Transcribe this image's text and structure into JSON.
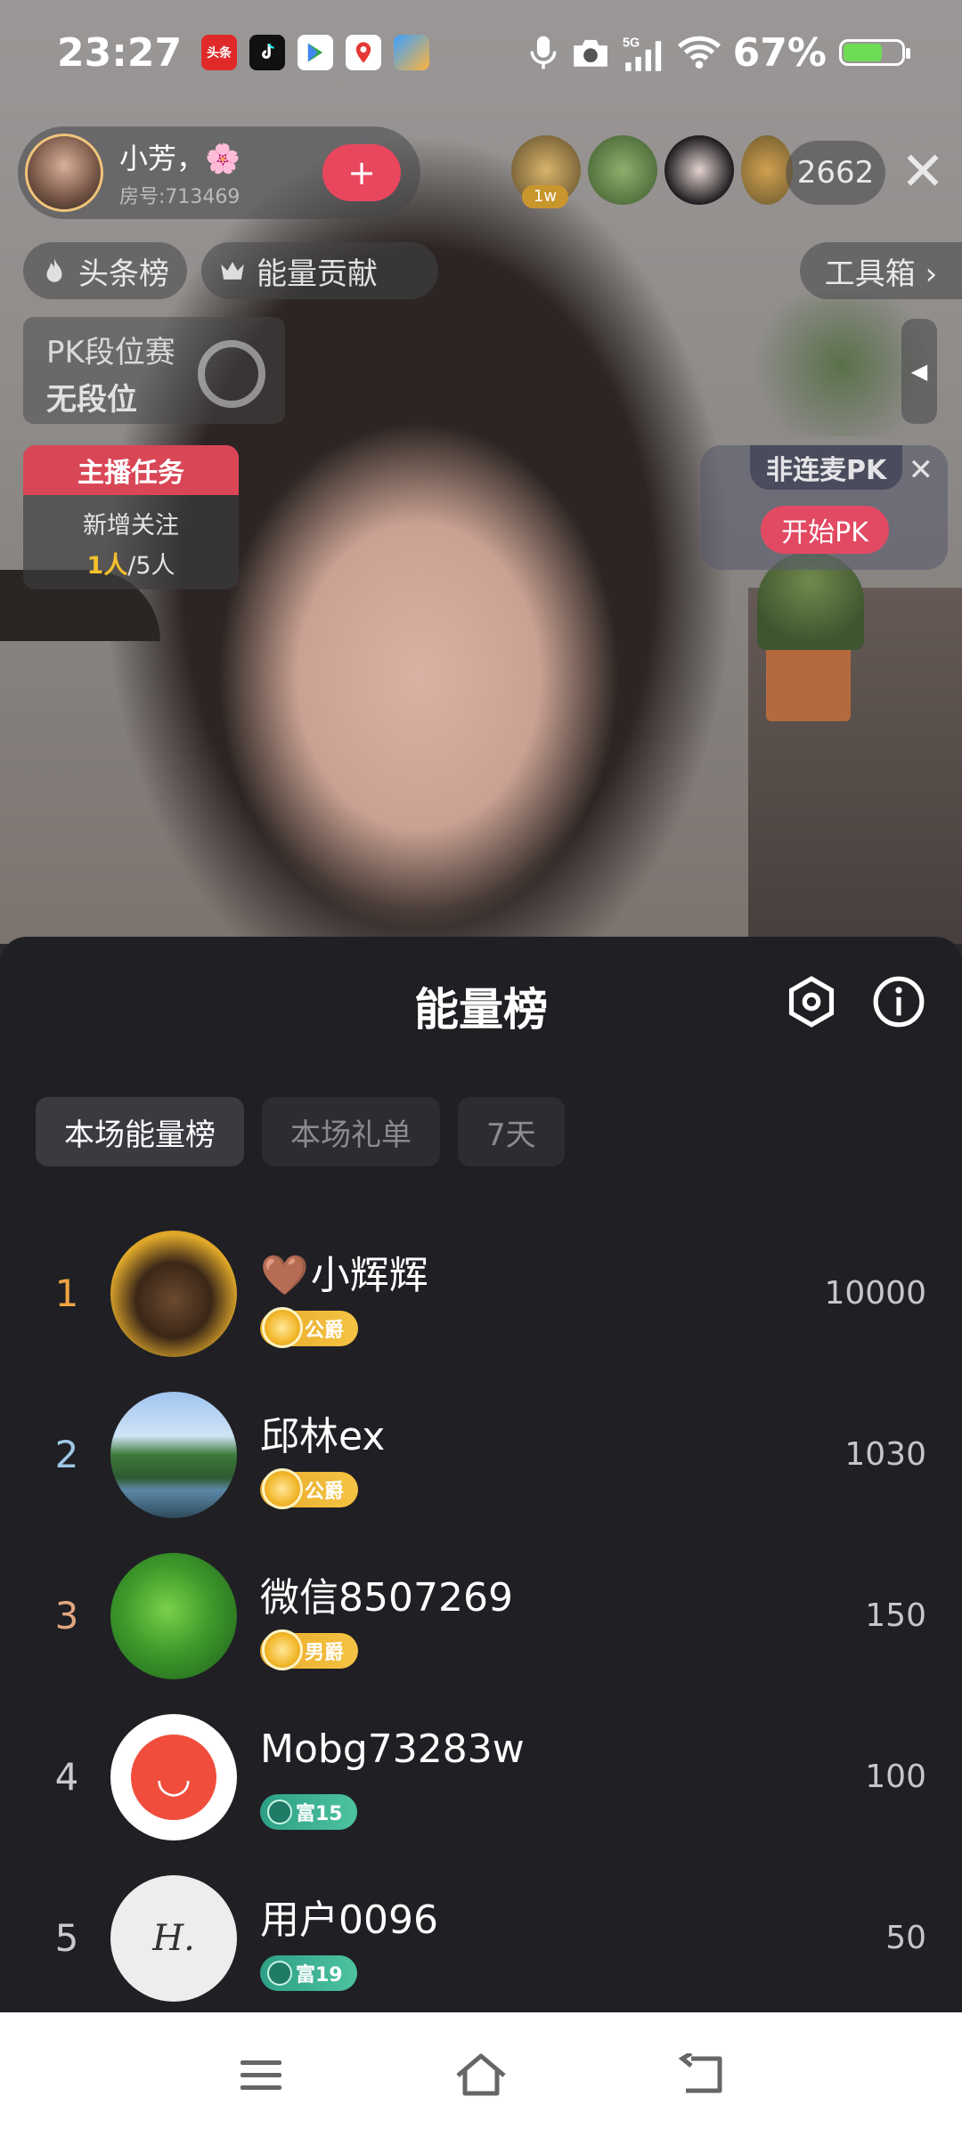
{
  "status_bar": {
    "time": "23:27",
    "notification_apps": [
      "toutiao",
      "tiktok",
      "google-play",
      "map",
      "files"
    ],
    "toutiao_label": "头条",
    "battery_percent": "67%",
    "battery_level": 0.67,
    "network": "5G"
  },
  "stream": {
    "host_name": "小芳，🌸",
    "room_number": "房号:713469",
    "follow_label": "+",
    "viewer_top_badge": "1w",
    "viewer_count": "2662",
    "close_label": "✕",
    "chips": {
      "headline": "头条榜",
      "energy": "能量贡献",
      "tools": "工具箱 ›"
    },
    "pk_rank": {
      "title": "PK段位赛",
      "value": "无段位"
    },
    "collapse_label": "◀",
    "task": {
      "title": "主播任务",
      "desc": "新增关注",
      "done": "1人",
      "total": "/5人"
    },
    "pk_card": {
      "title": "非连麦PK",
      "start_label": "开始PK",
      "close_label": "✕"
    }
  },
  "sheet": {
    "title": "能量榜",
    "tabs": [
      "本场能量榜",
      "本场礼单",
      "7天"
    ],
    "active_tab": 0,
    "ranking": [
      {
        "rank": "1",
        "name": "小辉辉",
        "heart": "🤎",
        "badge": "公爵",
        "badge_type": "gold",
        "score": "10000",
        "rank_color": "#f0a543"
      },
      {
        "rank": "2",
        "name": "邱林ex",
        "heart": "",
        "badge": "公爵",
        "badge_type": "gold",
        "score": "1030",
        "rank_color": "#9fc8e6"
      },
      {
        "rank": "3",
        "name": "微信8507269",
        "heart": "",
        "badge": "男爵",
        "badge_type": "gold",
        "score": "150",
        "rank_color": "#e2a680"
      },
      {
        "rank": "4",
        "name": "Mobg73283w",
        "heart": "",
        "badge": "富15",
        "badge_type": "teal",
        "score": "100",
        "rank_color": "#c9c9cf"
      },
      {
        "rank": "5",
        "name": "用户0096",
        "heart": "",
        "badge": "富19",
        "badge_type": "teal",
        "score": "50",
        "rank_color": "#c9c9cf"
      }
    ]
  },
  "nav": {
    "buttons": [
      "menu",
      "home",
      "back"
    ]
  }
}
